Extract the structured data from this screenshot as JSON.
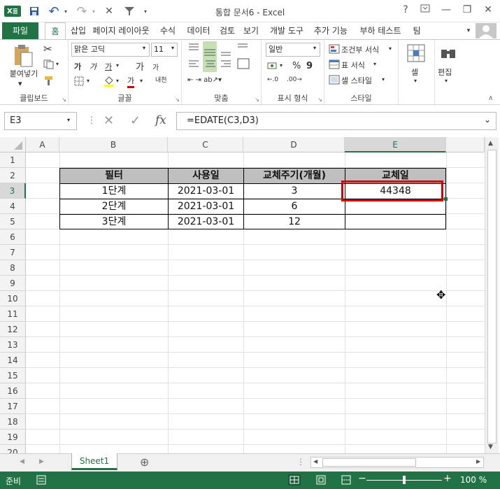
{
  "window": {
    "title": "통합 문서6 - Excel",
    "help": "?",
    "minimize": "—",
    "restore": "❐",
    "close": "✕"
  },
  "quick_access": {
    "excel": "X≣",
    "save": "💾",
    "undo": "↶",
    "redo": "↷",
    "clear": "✕",
    "filter": "▼"
  },
  "tabs": [
    "파일",
    "홈",
    "삽입",
    "페이지 레이아웃",
    "수식",
    "데이터",
    "검토",
    "보기",
    "개발 도구",
    "추가 기능",
    "부하 테스트",
    "팀"
  ],
  "ribbon": {
    "clipboard": {
      "paste": "붙여넣기",
      "label": "클립보드"
    },
    "font": {
      "name": "맑은 고딕",
      "size": "11",
      "label": "글꼴",
      "bold": "가",
      "italic": "가",
      "underline": "가",
      "grow": "가",
      "shrink": "가",
      "color": "가",
      "phonetic": "내천"
    },
    "alignment": {
      "label": "맞춤"
    },
    "number": {
      "format": "일반",
      "label": "표시 형식",
      "percent": "%",
      "comma": "9"
    },
    "styles": {
      "conditional": "조건부 서식",
      "table": "표 서식",
      "cell_styles": "셀 스타일",
      "label": "스타일"
    },
    "cells": {
      "label": "셀"
    },
    "editing": {
      "label": "편집"
    }
  },
  "formula_bar": {
    "name_box": "E3",
    "formula": "=EDATE(C3,D3)",
    "fx": "fx"
  },
  "columns": [
    "A",
    "B",
    "C",
    "D",
    "E"
  ],
  "rows": [
    "1",
    "2",
    "3",
    "4",
    "5",
    "6",
    "7",
    "8",
    "9",
    "10",
    "11",
    "12",
    "13",
    "14",
    "15",
    "16",
    "17",
    "18",
    "19",
    "20"
  ],
  "table": {
    "headers": [
      "필터",
      "사용일",
      "교체주기(개월)",
      "교체일"
    ],
    "rows": [
      [
        "1단계",
        "2021-03-01",
        "3",
        "44348"
      ],
      [
        "2단계",
        "2021-03-01",
        "6",
        ""
      ],
      [
        "3단계",
        "2021-03-01",
        "12",
        ""
      ]
    ]
  },
  "sheet_tabs": {
    "active": "Sheet1",
    "add": "⊕"
  },
  "status": {
    "mode": "준비",
    "zoom": "100 %"
  },
  "colors": {
    "accent": "#217346",
    "selection": "#d00000",
    "header_fill": "#bfbfbf"
  }
}
